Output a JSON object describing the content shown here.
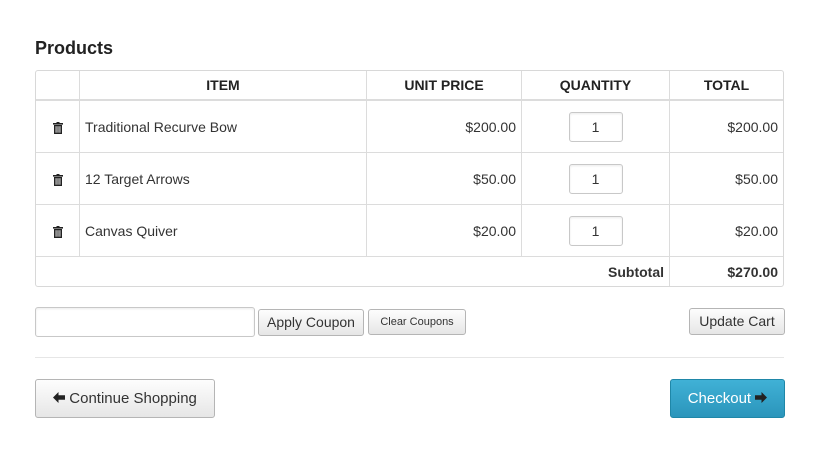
{
  "products_heading": "Products",
  "table": {
    "headers": {
      "item": "ITEM",
      "unit_price": "UNIT PRICE",
      "quantity": "QUANTITY",
      "total": "TOTAL"
    },
    "rows": [
      {
        "item": "Traditional Recurve Bow",
        "unit_price": "$200.00",
        "quantity": "1",
        "total": "$200.00"
      },
      {
        "item": "12 Target Arrows",
        "unit_price": "$50.00",
        "quantity": "1",
        "total": "$50.00"
      },
      {
        "item": "Canvas Quiver",
        "unit_price": "$20.00",
        "quantity": "1",
        "total": "$20.00"
      }
    ],
    "subtotal_label": "Subtotal",
    "subtotal_value": "$270.00"
  },
  "coupon": {
    "value": "",
    "placeholder": ""
  },
  "buttons": {
    "apply_coupon": "Apply Coupon",
    "clear_coupons": "Clear Coupons",
    "update_cart": "Update Cart",
    "continue_shopping": "Continue Shopping",
    "checkout": "Checkout"
  },
  "colors": {
    "checkout_bg": "#35a3c8",
    "border": "#dcdcdc"
  },
  "icons": {
    "delete": "trash-icon",
    "back": "arrow-left-icon",
    "forward": "arrow-right-icon"
  }
}
